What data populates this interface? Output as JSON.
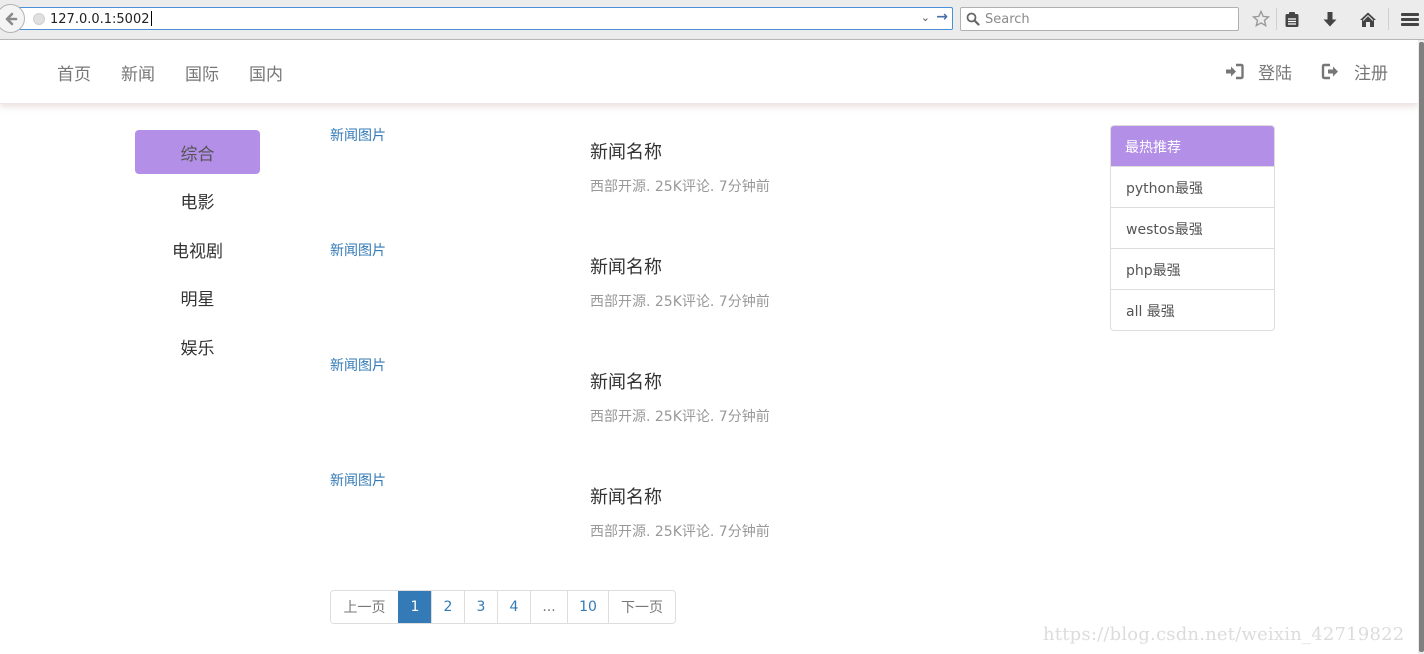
{
  "browser": {
    "url": "127.0.0.1:5002",
    "search_placeholder": "Search",
    "toolbar_icons": [
      "back-icon",
      "star-icon",
      "clipboard-icon",
      "download-icon",
      "home-icon",
      "menu-icon"
    ]
  },
  "navbar": {
    "left_items": [
      {
        "label": "首页"
      },
      {
        "label": "新闻"
      },
      {
        "label": "国际"
      },
      {
        "label": "国内"
      }
    ],
    "login": {
      "label": "登陆",
      "icon": "log-in-icon"
    },
    "register": {
      "label": "注册",
      "icon": "log-out-icon"
    }
  },
  "sidebar": {
    "items": [
      {
        "label": "综合",
        "active": true
      },
      {
        "label": "电影",
        "active": false
      },
      {
        "label": "电视剧",
        "active": false
      },
      {
        "label": "明星",
        "active": false
      },
      {
        "label": "娱乐",
        "active": false
      }
    ]
  },
  "news": {
    "items": [
      {
        "image_alt": "新闻图片",
        "title": "新闻名称",
        "meta": "西部开源. 25K评论. 7分钟前"
      },
      {
        "image_alt": "新闻图片",
        "title": "新闻名称",
        "meta": "西部开源. 25K评论. 7分钟前"
      },
      {
        "image_alt": "新闻图片",
        "title": "新闻名称",
        "meta": "西部开源. 25K评论. 7分钟前"
      },
      {
        "image_alt": "新闻图片",
        "title": "新闻名称",
        "meta": "西部开源. 25K评论. 7分钟前"
      }
    ]
  },
  "pagination": {
    "prev": "上一页",
    "pages": [
      "1",
      "2",
      "3",
      "4",
      "...",
      "10"
    ],
    "current": "1",
    "next": "下一页"
  },
  "hot": {
    "title": "最热推荐",
    "items": [
      "python最强",
      "westos最强",
      "php最强",
      "all 最强"
    ]
  },
  "watermark": "https://blog.csdn.net/weixin_42719822",
  "colors": {
    "accent_purple": "#b48fe8",
    "link_blue": "#337ab7"
  }
}
